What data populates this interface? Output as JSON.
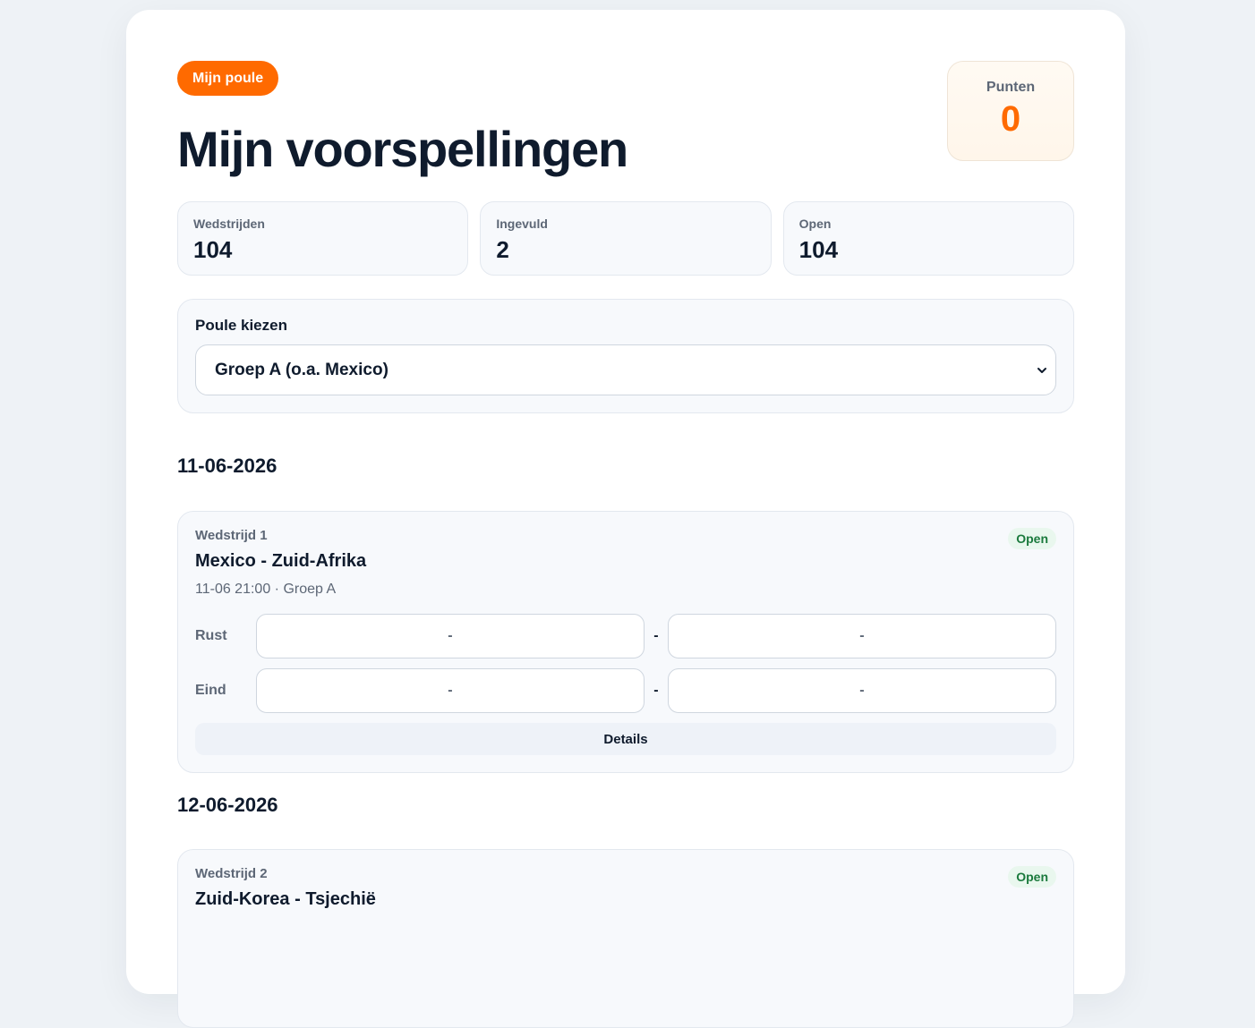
{
  "header": {
    "badge": "Mijn poule",
    "title": "Mijn voorspellingen",
    "points_label": "Punten",
    "points_value": "0"
  },
  "stats": [
    {
      "label": "Wedstrijden",
      "value": "104"
    },
    {
      "label": "Ingevuld",
      "value": "2"
    },
    {
      "label": "Open",
      "value": "104"
    }
  ],
  "poule": {
    "label": "Poule kiezen",
    "selected": "Groep A (o.a. Mexico)"
  },
  "days": [
    {
      "date": "11-06-2026",
      "match": {
        "number": "Wedstrijd 1",
        "teams": "Mexico - Zuid-Afrika",
        "meta": "11-06 21:00 · Groep A",
        "status": "Open",
        "half_label": "Rust",
        "final_label": "Eind",
        "score_placeholder": "-",
        "separator": "-",
        "details_label": "Details"
      }
    },
    {
      "date": "12-06-2026",
      "match": {
        "number": "Wedstrijd 2",
        "teams": "Zuid-Korea - Tsjechië",
        "status": "Open"
      }
    }
  ],
  "colors": {
    "accent": "#ff6a00",
    "open_bg": "#e9f7ee",
    "open_text": "#1b7a3d"
  }
}
